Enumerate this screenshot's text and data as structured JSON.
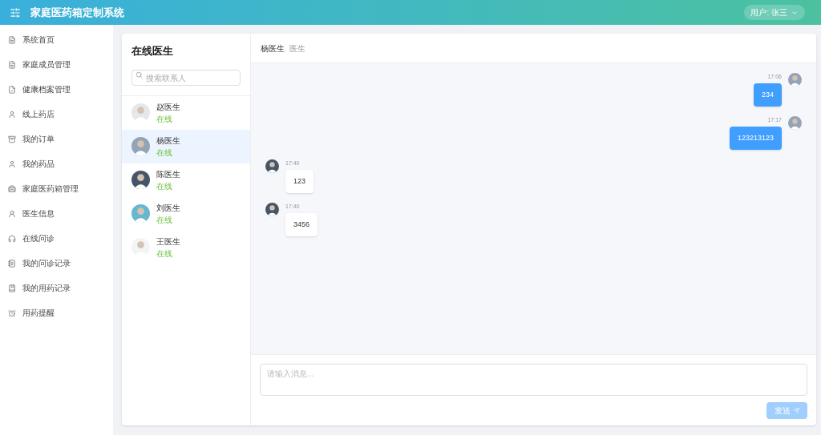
{
  "header": {
    "title": "家庭医药箱定制系统",
    "user": "用户: 张三"
  },
  "sidebar": {
    "items": [
      {
        "label": "系统首页"
      },
      {
        "label": "家庭成员管理"
      },
      {
        "label": "健康档案管理"
      },
      {
        "label": "线上药店"
      },
      {
        "label": "我的订单"
      },
      {
        "label": "我的药品"
      },
      {
        "label": "家庭医药箱管理"
      },
      {
        "label": "医生信息"
      },
      {
        "label": "在线问诊"
      },
      {
        "label": "我的问诊记录"
      },
      {
        "label": "我的用药记录"
      },
      {
        "label": "用药提醒"
      }
    ]
  },
  "contacts": {
    "title": "在线医生",
    "search": {
      "placeholder": "搜索联系人"
    },
    "items": [
      {
        "name": "赵医生",
        "status": "在线",
        "selected": false
      },
      {
        "name": "杨医生",
        "status": "在线",
        "selected": true
      },
      {
        "name": "陈医生",
        "status": "在线",
        "selected": false
      },
      {
        "name": "刘医生",
        "status": "在线",
        "selected": false
      },
      {
        "name": "王医生",
        "status": "在线",
        "selected": false
      }
    ]
  },
  "chat": {
    "name": "杨医生",
    "role": "医生",
    "messages": [
      {
        "kind": "sent",
        "time": "17:06",
        "text": "234"
      },
      {
        "kind": "sent",
        "time": "17:17",
        "text": "123213123"
      },
      {
        "kind": "received",
        "time": "17:40",
        "text": "123"
      },
      {
        "kind": "received",
        "time": "17:40",
        "text": "3456"
      }
    ],
    "input": {
      "placeholder": "请输入消息..."
    },
    "send": {
      "label": "发送",
      "disabled": true
    }
  }
}
